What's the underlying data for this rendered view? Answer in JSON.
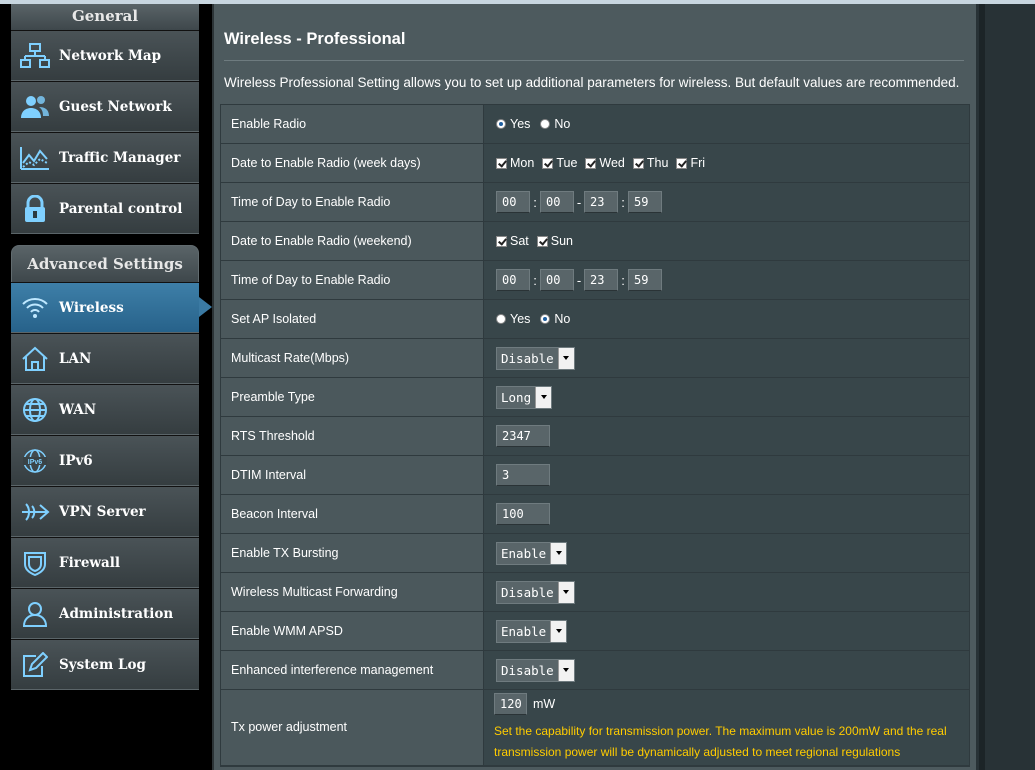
{
  "sidebar": {
    "general_header": "General",
    "general_items": [
      {
        "label": "Network Map"
      },
      {
        "label": "Guest Network"
      },
      {
        "label": "Traffic Manager"
      },
      {
        "label": "Parental control"
      }
    ],
    "advanced_header": "Advanced Settings",
    "advanced_items": [
      {
        "label": "Wireless"
      },
      {
        "label": "LAN"
      },
      {
        "label": "WAN"
      },
      {
        "label": "IPv6"
      },
      {
        "label": "VPN Server"
      },
      {
        "label": "Firewall"
      },
      {
        "label": "Administration"
      },
      {
        "label": "System Log"
      }
    ],
    "active_item": "Wireless"
  },
  "page": {
    "title": "Wireless - Professional",
    "description": "Wireless Professional Setting allows you to set up additional parameters for wireless. But default values are recommended."
  },
  "form": {
    "enable_radio": {
      "label": "Enable Radio",
      "yes": "Yes",
      "no": "No",
      "selected": "Yes"
    },
    "weekday_radio": {
      "label": "Date to Enable Radio (week days)",
      "days": [
        "Mon",
        "Tue",
        "Wed",
        "Thu",
        "Fri"
      ]
    },
    "weekday_time": {
      "label": "Time of Day to Enable Radio",
      "start_hour": "00",
      "start_min": "00",
      "end_hour": "23",
      "end_min": "59"
    },
    "weekend_radio": {
      "label": "Date to Enable Radio (weekend)",
      "days": [
        "Sat",
        "Sun"
      ]
    },
    "weekend_time": {
      "label": "Time of Day to Enable Radio",
      "start_hour": "00",
      "start_min": "00",
      "end_hour": "23",
      "end_min": "59"
    },
    "ap_isolated": {
      "label": "Set AP Isolated",
      "yes": "Yes",
      "no": "No",
      "selected": "No"
    },
    "multicast_rate": {
      "label": "Multicast Rate(Mbps)",
      "value": "Disable"
    },
    "preamble": {
      "label": "Preamble Type",
      "value": "Long"
    },
    "rts": {
      "label": "RTS Threshold",
      "value": "2347"
    },
    "dtim": {
      "label": "DTIM Interval",
      "value": "3"
    },
    "beacon": {
      "label": "Beacon Interval",
      "value": "100"
    },
    "tx_bursting": {
      "label": "Enable TX Bursting",
      "value": "Enable"
    },
    "multicast_fwd": {
      "label": "Wireless Multicast Forwarding",
      "value": "Disable"
    },
    "wmm_apsd": {
      "label": "Enable WMM APSD",
      "value": "Enable"
    },
    "interference": {
      "label": "Enhanced interference management",
      "value": "Disable"
    },
    "tx_power": {
      "label": "Tx power adjustment",
      "value": "120",
      "unit": "mW",
      "hint": "Set the capability for transmission power. The maximum value is 200mW and the real transmission power will be dynamically adjusted to meet regional regulations"
    }
  },
  "colors": {
    "accent": "#3b7aa3",
    "hint": "#ffcc00",
    "panel": "#4d5a5e"
  }
}
